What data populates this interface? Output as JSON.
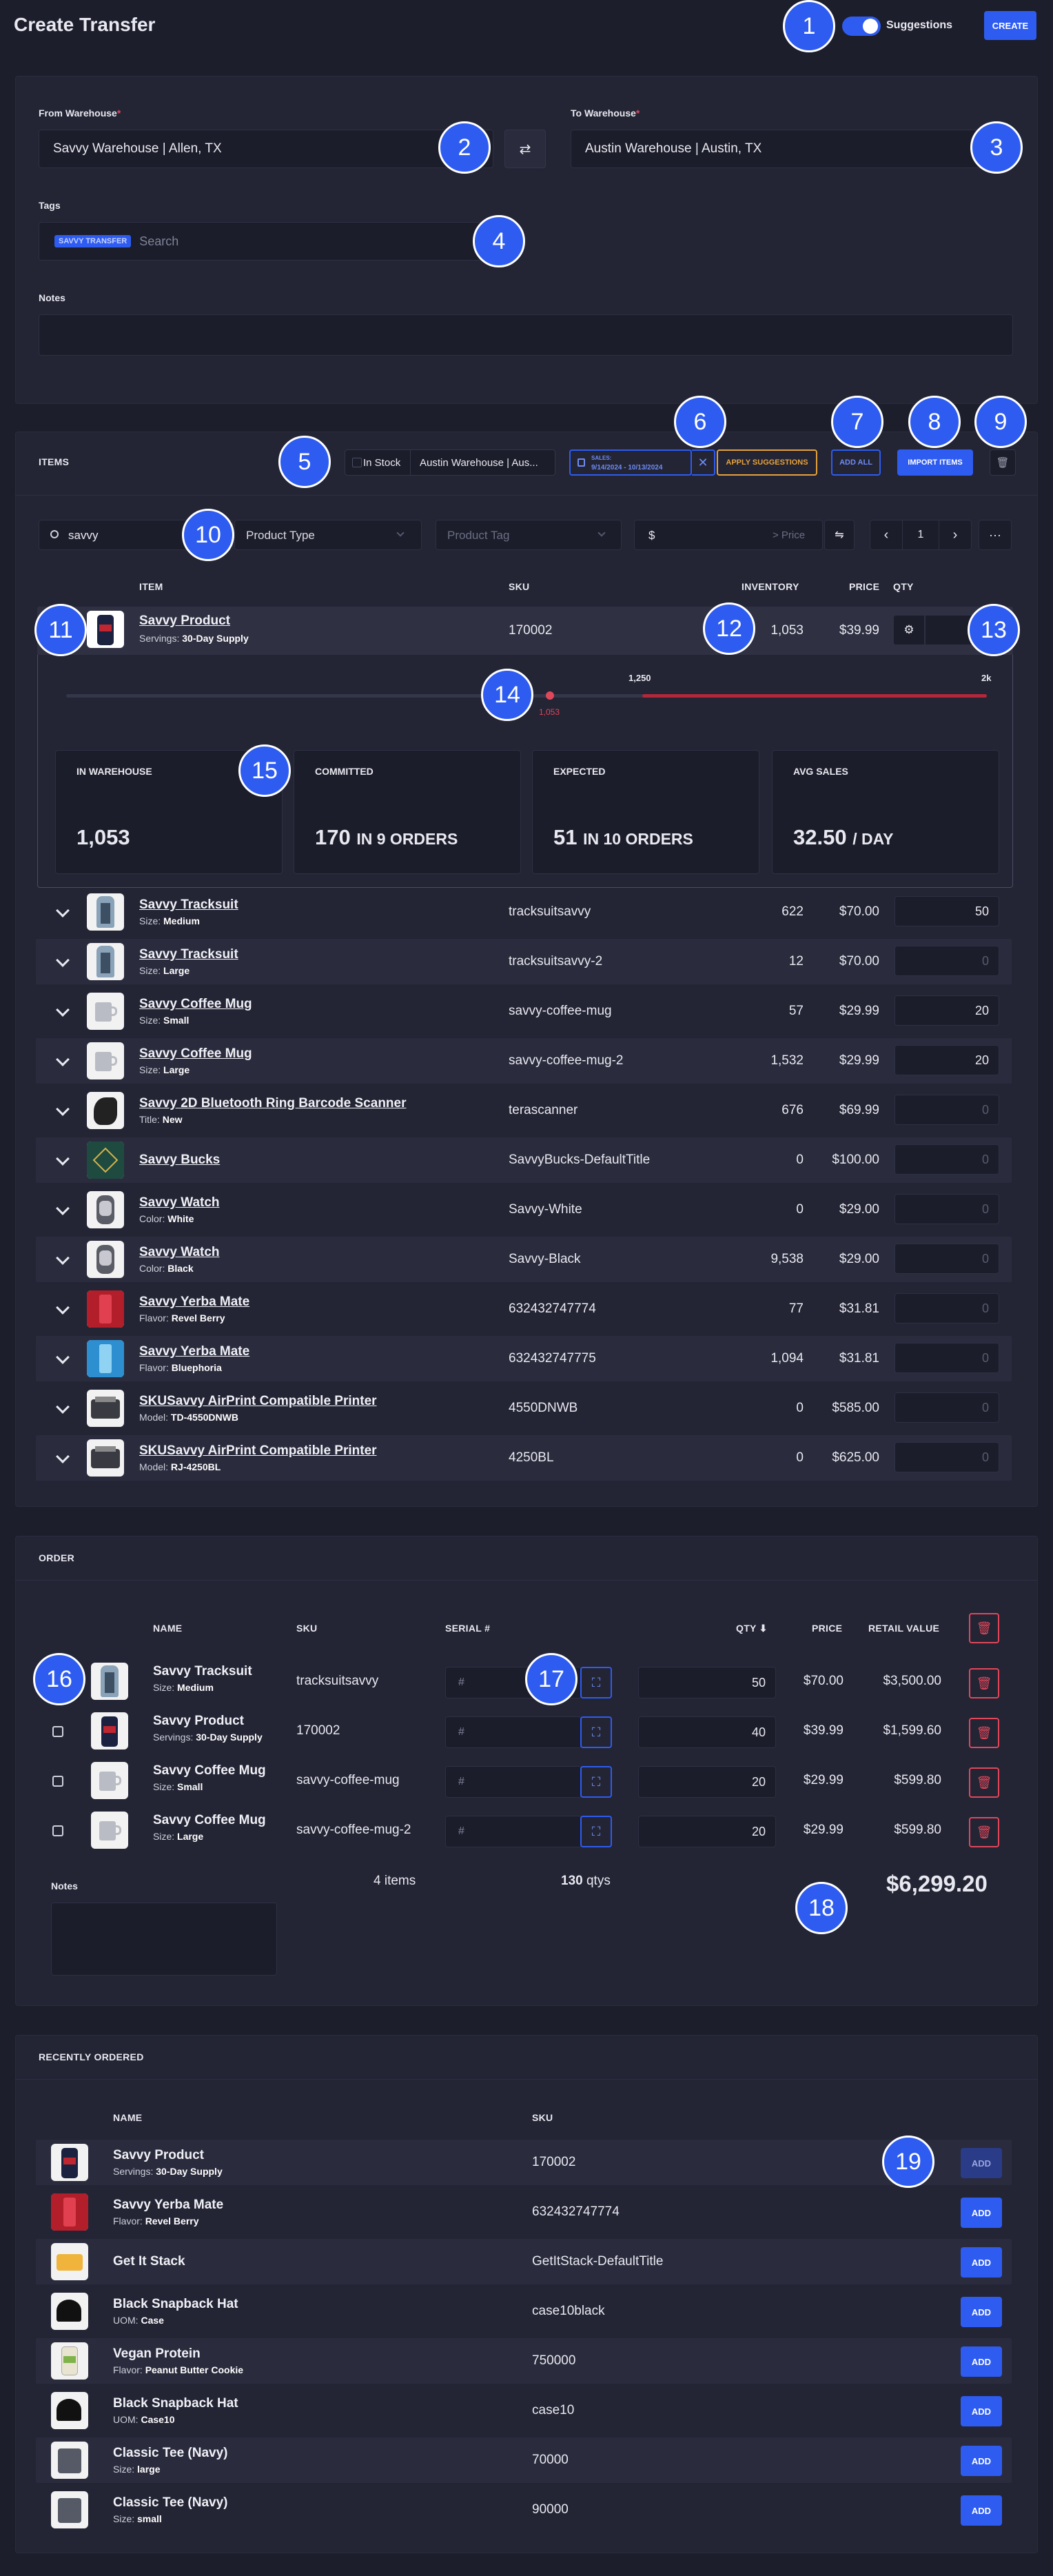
{
  "header": {
    "title": "Create Transfer",
    "suggestions_label": "Suggestions",
    "create_label": "CREATE"
  },
  "form": {
    "from_label": "From Warehouse",
    "from_value": "Savvy Warehouse | Allen, TX",
    "to_label": "To Warehouse",
    "to_value": "Austin Warehouse | Austin, TX",
    "tags_label": "Tags",
    "tag_chip": "SAVVY TRANSFER",
    "tags_placeholder": "Search",
    "notes_label": "Notes"
  },
  "items": {
    "title": "ITEMS",
    "in_stock_label": "In Stock",
    "warehouse_filter": "Austin Warehouse | Aus...",
    "sales_label": "SALES:",
    "sales_range": "9/14/2024 - 10/13/2024",
    "apply_label": "APPLY SUGGESTIONS",
    "add_all_label": "ADD ALL",
    "import_label": "IMPORT ITEMS",
    "search_value": "savvy",
    "product_type_placeholder": "Product Type",
    "product_tag_placeholder": "Product Tag",
    "price_prefix": "$",
    "price_placeholder": "> Price",
    "page": "1",
    "columns": {
      "item": "ITEM",
      "sku": "SKU",
      "inventory": "INVENTORY",
      "price": "PRICE",
      "qty": "QTY"
    },
    "expanded": {
      "name": "Savvy Product",
      "variant_key": "Servings:",
      "variant_val": "30-Day Supply",
      "sku": "170002",
      "inventory": "1,053",
      "price": "$39.99",
      "slider_mid": "1,250",
      "slider_max": "2k",
      "slider_marker": "1,053",
      "stats": {
        "in_warehouse_label": "IN WAREHOUSE",
        "in_warehouse": "1,053",
        "committed_label": "COMMITTED",
        "committed": "170",
        "committed_unit": "IN 9 ORDERS",
        "expected_label": "EXPECTED",
        "expected": "51",
        "expected_unit": "IN 10 ORDERS",
        "avg_label": "AVG SALES",
        "avg": "32.50",
        "avg_unit": "/ DAY"
      }
    },
    "rows": [
      {
        "name": "Savvy Tracksuit",
        "vk": "Size:",
        "vv": "Medium",
        "sku": "tracksuitsavvy",
        "inv": "622",
        "price": "$70.00",
        "qty": "50"
      },
      {
        "name": "Savvy Tracksuit",
        "vk": "Size:",
        "vv": "Large",
        "sku": "tracksuitsavvy-2",
        "inv": "12",
        "price": "$70.00",
        "qty": "0"
      },
      {
        "name": "Savvy Coffee Mug",
        "vk": "Size:",
        "vv": "Small",
        "sku": "savvy-coffee-mug",
        "inv": "57",
        "price": "$29.99",
        "qty": "20"
      },
      {
        "name": "Savvy Coffee Mug",
        "vk": "Size:",
        "vv": "Large",
        "sku": "savvy-coffee-mug-2",
        "inv": "1,532",
        "price": "$29.99",
        "qty": "20"
      },
      {
        "name": "Savvy 2D Bluetooth Ring Barcode Scanner",
        "vk": "Title:",
        "vv": "New",
        "sku": "terascanner",
        "inv": "676",
        "price": "$69.99",
        "qty": "0"
      },
      {
        "name": "Savvy Bucks",
        "vk": "",
        "vv": "",
        "sku": "SavvyBucks-DefaultTitle",
        "inv": "0",
        "price": "$100.00",
        "qty": "0"
      },
      {
        "name": "Savvy Watch",
        "vk": "Color:",
        "vv": "White",
        "sku": "Savvy-White",
        "inv": "0",
        "price": "$29.00",
        "qty": "0"
      },
      {
        "name": "Savvy Watch",
        "vk": "Color:",
        "vv": "Black",
        "sku": "Savvy-Black",
        "inv": "9,538",
        "price": "$29.00",
        "qty": "0"
      },
      {
        "name": "Savvy Yerba Mate",
        "vk": "Flavor:",
        "vv": "Revel Berry",
        "sku": "632432747774",
        "inv": "77",
        "price": "$31.81",
        "qty": "0"
      },
      {
        "name": "Savvy Yerba Mate",
        "vk": "Flavor:",
        "vv": "Bluephoria",
        "sku": "632432747775",
        "inv": "1,094",
        "price": "$31.81",
        "qty": "0"
      },
      {
        "name": "SKUSavvy AirPrint Compatible Printer",
        "vk": "Model:",
        "vv": "TD-4550DNWB",
        "sku": "4550DNWB",
        "inv": "0",
        "price": "$585.00",
        "qty": "0"
      },
      {
        "name": "SKUSavvy AirPrint Compatible Printer",
        "vk": "Model:",
        "vv": "RJ-4250BL",
        "sku": "4250BL",
        "inv": "0",
        "price": "$625.00",
        "qty": "0"
      }
    ]
  },
  "order": {
    "title": "ORDER",
    "columns": {
      "name": "NAME",
      "sku": "SKU",
      "serial": "SERIAL #",
      "qty": "QTY",
      "price": "PRICE",
      "retail": "RETAIL VALUE"
    },
    "serial_placeholder": "#",
    "rows": [
      {
        "name": "Savvy Tracksuit",
        "vk": "Size:",
        "vv": "Medium",
        "sku": "tracksuitsavvy",
        "qty": "50",
        "price": "$70.00",
        "retail": "$3,500.00"
      },
      {
        "name": "Savvy Product",
        "vk": "Servings:",
        "vv": "30-Day Supply",
        "sku": "170002",
        "qty": "40",
        "price": "$39.99",
        "retail": "$1,599.60"
      },
      {
        "name": "Savvy Coffee Mug",
        "vk": "Size:",
        "vv": "Small",
        "sku": "savvy-coffee-mug",
        "qty": "20",
        "price": "$29.99",
        "retail": "$599.80"
      },
      {
        "name": "Savvy Coffee Mug",
        "vk": "Size:",
        "vv": "Large",
        "sku": "savvy-coffee-mug-2",
        "qty": "20",
        "price": "$29.99",
        "retail": "$599.80"
      }
    ],
    "notes_label": "Notes",
    "items_count": "4 items",
    "qtys_count": "130",
    "qtys_label": "qtys",
    "total": "$6,299.20"
  },
  "recent": {
    "title": "RECENTLY ORDERED",
    "columns": {
      "name": "NAME",
      "sku": "SKU"
    },
    "add_label": "ADD",
    "rows": [
      {
        "name": "Savvy Product",
        "vk": "Servings:",
        "vv": "30-Day Supply",
        "sku": "170002"
      },
      {
        "name": "Savvy Yerba Mate",
        "vk": "Flavor:",
        "vv": "Revel Berry",
        "sku": "632432747774"
      },
      {
        "name": "Get It Stack",
        "vk": "",
        "vv": "",
        "sku": "GetItStack-DefaultTitle"
      },
      {
        "name": "Black Snapback Hat",
        "vk": "UOM:",
        "vv": "Case",
        "sku": "case10black"
      },
      {
        "name": "Vegan Protein",
        "vk": "Flavor:",
        "vv": "Peanut Butter Cookie",
        "sku": "750000"
      },
      {
        "name": "Black Snapback Hat",
        "vk": "UOM:",
        "vv": "Case10",
        "sku": "case10"
      },
      {
        "name": "Classic Tee (Navy)",
        "vk": "Size:",
        "vv": "large",
        "sku": "70000"
      },
      {
        "name": "Classic Tee (Navy)",
        "vk": "Size:",
        "vv": "small",
        "sku": "90000"
      }
    ]
  },
  "badges": [
    "1",
    "2",
    "3",
    "4",
    "5",
    "6",
    "7",
    "8",
    "9",
    "10",
    "11",
    "12",
    "13",
    "14",
    "15",
    "16",
    "17",
    "18",
    "19"
  ],
  "colors": {
    "accent": "#2e5cf0",
    "danger": "#e0475a",
    "warning": "#e6a23c",
    "background": "#1d1e2c",
    "card": "#232434"
  }
}
